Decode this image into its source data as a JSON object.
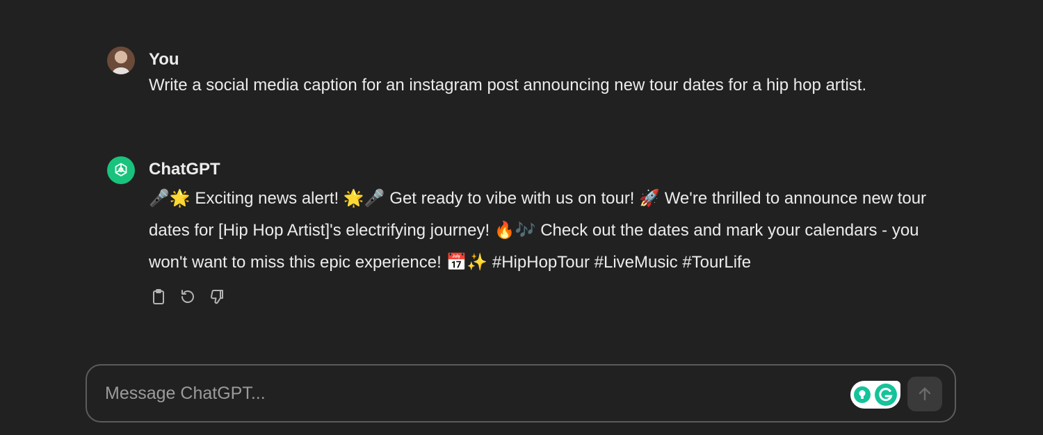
{
  "conversation": {
    "user_message": {
      "author": "You",
      "text": "Write a social media caption for an instagram post announcing new tour dates for a hip hop artist."
    },
    "assistant_message": {
      "author": "ChatGPT",
      "text": "🎤🌟 Exciting news alert! 🌟🎤 Get ready to vibe with us on tour! 🚀 We're thrilled to announce new tour dates for [Hip Hop Artist]'s electrifying journey! 🔥🎶 Check out the dates and mark your calendars - you won't want to miss this epic experience! 📅✨ #HipHopTour #LiveMusic #TourLife"
    },
    "actions": {
      "icons": [
        "clipboard-icon",
        "regenerate-icon",
        "thumbs-down-icon"
      ]
    }
  },
  "composer": {
    "placeholder": "Message ChatGPT..."
  },
  "colors": {
    "background": "#212121",
    "text": "#ececec",
    "placeholder": "#9b9b9b",
    "chatgpt_accent": "#19c37d",
    "grammarly_green": "#15c39a",
    "border": "#5c5c5c"
  }
}
